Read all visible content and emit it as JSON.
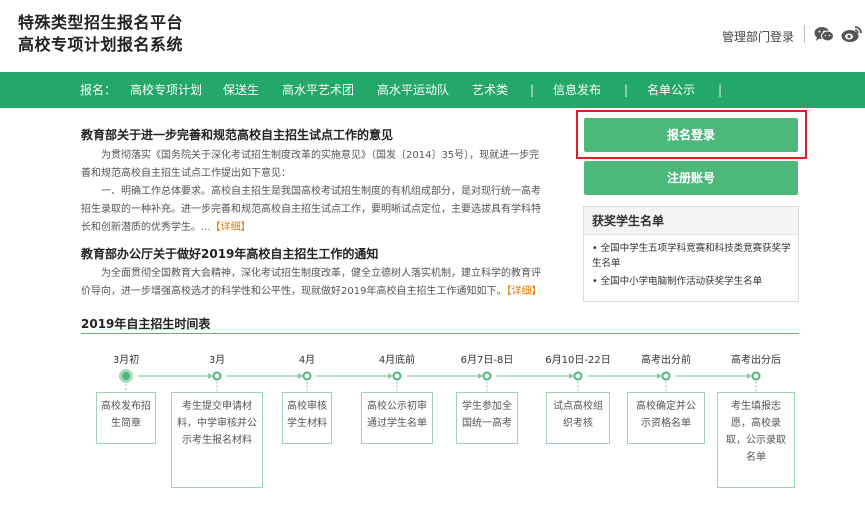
{
  "header": {
    "title_line1": "特殊类型招生报名平台",
    "title_line2": "高校专项计划报名系统",
    "admin_login": "管理部门登录",
    "icons": [
      "wechat-icon",
      "weibo-icon"
    ]
  },
  "nav": {
    "label": "报名：",
    "items": [
      "高校专项计划",
      "保送生",
      "高水平艺术团",
      "高水平运动队",
      "艺术类",
      "信息发布",
      "名单公示"
    ],
    "separator": "|"
  },
  "articles": [
    {
      "title": "教育部关于进一步完善和规范高校自主招生试点工作的意见",
      "para1": "为贯彻落实《国务院关于深化考试招生制度改革的实施意见》（国发〔2014〕35号），现就进一步完善和规范高校自主招生试点工作提出如下意见：",
      "para2": "一、明确工作总体要求。高校自主招生是我国高校考试招生制度的有机组成部分，是对现行统一高考招生录取的一种补充。进一步完善和规范高校自主招生试点工作，要明晰试点定位，主要选拔具有学科特长和创新潜质的优秀学生。...",
      "more": "【详细】"
    },
    {
      "title": "教育部办公厅关于做好2019年高校自主招生工作的通知",
      "para1": "为全面贯彻全国教育大会精神，深化考试招生制度改革，健全立德树人落实机制，建立科学的教育评价导向，进一步增强高校选才的科学性和公平性，现就做好2019年高校自主招生工作通知如下。",
      "more": "【详细】"
    }
  ],
  "sidebar": {
    "login_button": "报名登录",
    "register_button": "注册账号",
    "award_title": "获奖学生名单",
    "award_items": [
      "• 全国中学生五项学科竞赛和科技类竞赛获奖学生名单",
      "• 全国中小学电脑制作活动获奖学生名单"
    ]
  },
  "timeline": {
    "title": "2019年自主招生时间表",
    "stages": [
      {
        "date": "3月初",
        "desc": "高校发布招生简章",
        "active": true
      },
      {
        "date": "3月",
        "desc": "考生提交申请材料，中学审核并公示考生报名材料",
        "active": false
      },
      {
        "date": "4月",
        "desc": "高校审核学生材料",
        "active": false
      },
      {
        "date": "4月底前",
        "desc": "高校公示初审通过学生名单",
        "active": false
      },
      {
        "date": "6月7日-8日",
        "desc": "学生参加全国统一高考",
        "active": false
      },
      {
        "date": "6月10日-22日",
        "desc": "试点高校组织考核",
        "active": false
      },
      {
        "date": "高考出分前",
        "desc": "高校确定并公示资格名单",
        "active": false
      },
      {
        "date": "高考出分后",
        "desc": "考生填报志愿，高校录取，公示录取名单",
        "active": false
      }
    ],
    "accent_color": "#4cb97a"
  }
}
